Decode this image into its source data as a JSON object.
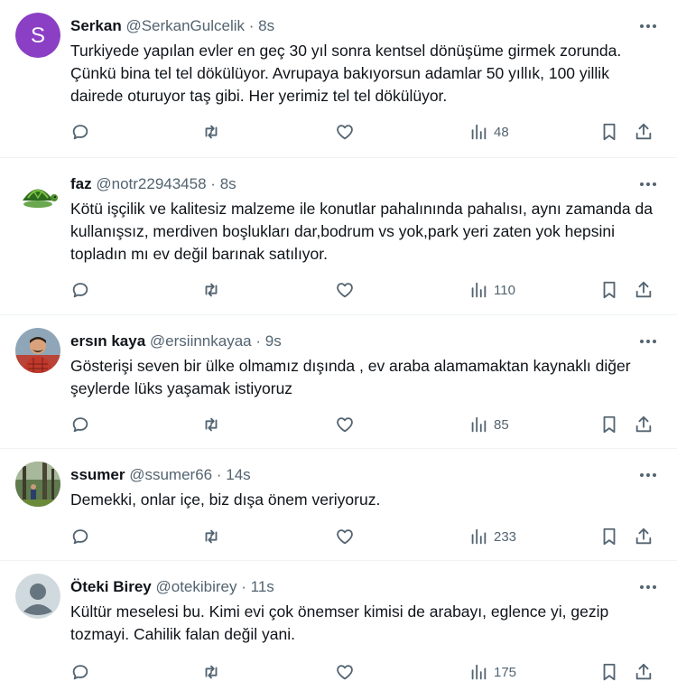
{
  "colors": {
    "text": "#0f1419",
    "muted": "#536471",
    "divider": "#eff3f4",
    "avatar_s": "#8b3fc4"
  },
  "tweets": [
    {
      "name": "Serkan",
      "handle": "@SerkanGulcelik",
      "dot": "·",
      "time": "8s",
      "avatar_letter": "S",
      "avatar": "letter-avatar",
      "text": "Turkiyede yapılan evler en geç 30 yıl sonra kentsel dönüşüme girmek zorunda. Çünkü bina tel tel dökülüyor. Avrupaya bakıyorsun adamlar 50 yıllık, 100 yillik dairede oturuyor taş gibi.  Her yerimiz tel tel dökülüyor.",
      "views": "48"
    },
    {
      "name": "faz",
      "handle": "@notr22943458",
      "dot": "·",
      "time": "8s",
      "avatar": "turtle-avatar",
      "text": "Kötü işçilik ve kalitesiz malzeme ile konutlar pahalınında pahalısı, aynı zamanda da kullanışsız, merdiven boşlukları dar,bodrum vs yok,park yeri zaten yok hepsini topladın mı ev değil barınak satılıyor.",
      "views": "110"
    },
    {
      "name": "ersın kaya",
      "handle": "@ersiinnkayaa",
      "dot": "·",
      "time": "9s",
      "avatar": "person-photo-avatar",
      "text": "Gösterişi seven bir ülke olmamız dışında , ev araba alamamaktan kaynaklı diğer şeylerde lüks yaşamak istiyoruz",
      "views": "85"
    },
    {
      "name": "ssumer",
      "handle": "@ssumer66",
      "dot": "·",
      "time": "14s",
      "avatar": "forest-photo-avatar",
      "text": "Demekki, onlar içe, biz dışa önem veriyoruz.",
      "views": "233"
    },
    {
      "name": "Öteki Birey",
      "handle": "@otekibirey",
      "dot": "·",
      "time": "11s",
      "avatar": "default-avatar",
      "text": "Kültür meselesi bu. Kimi evi çok önemser kimisi de arabayı, eglence yi, gezip tozmayi. Cahilik falan değil yani.",
      "views": "175"
    }
  ],
  "icons": [
    "more-icon",
    "reply-icon",
    "retweet-icon",
    "like-icon",
    "views-icon",
    "bookmark-icon",
    "share-icon"
  ]
}
